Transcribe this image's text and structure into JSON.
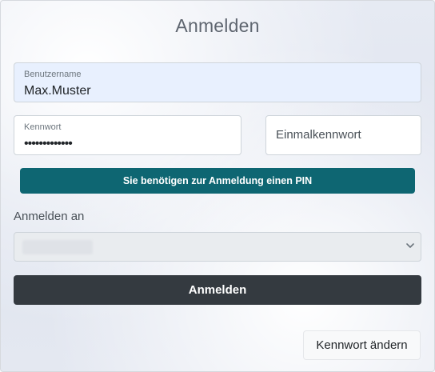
{
  "title": "Anmelden",
  "username": {
    "label": "Benutzername",
    "value": "Max.Muster"
  },
  "password": {
    "label": "Kennwort",
    "value": "•••••••••••••"
  },
  "otp": {
    "placeholder": "Einmalkennwort"
  },
  "pin_notice": "Sie benötigen zur Anmeldung einen PIN",
  "login_target": {
    "label": "Anmelden an",
    "selected": ""
  },
  "buttons": {
    "login": "Anmelden",
    "change_password": "Kennwort ändern"
  },
  "colors": {
    "pin_button": "#0e6672",
    "login_button": "#343a40",
    "autofill_bg": "#e8f0fe"
  }
}
